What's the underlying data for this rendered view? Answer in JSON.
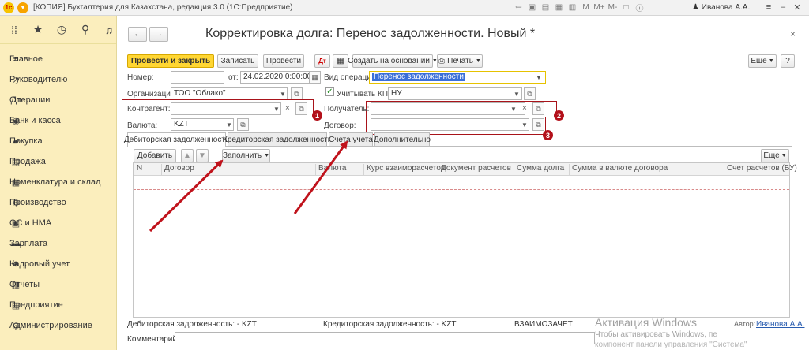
{
  "window": {
    "logo": "1c",
    "title": "[КОПИЯ] Бухгалтерия для Казахстана, редакция 3.0  (1С:Предприятие)",
    "user": "Иванова А.А.",
    "tb_icons": [
      "arrow-left-icon",
      "lock-icon",
      "calendar-icon",
      "chart-icon",
      "note-icon",
      "M",
      "M+",
      "M-",
      "maximize-icon",
      "info-icon"
    ]
  },
  "sidebar": {
    "items": [
      {
        "label": "Главное",
        "icon": "menu-icon"
      },
      {
        "label": "Руководителю",
        "icon": "trend-icon"
      },
      {
        "label": "Операции",
        "icon": "operations-icon"
      },
      {
        "label": "Банк и касса",
        "icon": "bank-icon"
      },
      {
        "label": "Покупка",
        "icon": "cart-icon"
      },
      {
        "label": "Продажа",
        "icon": "sale-icon"
      },
      {
        "label": "Номенклатура и склад",
        "icon": "warehouse-icon"
      },
      {
        "label": "Производство",
        "icon": "factory-icon"
      },
      {
        "label": "ОС и НМА",
        "icon": "assets-icon"
      },
      {
        "label": "Зарплата",
        "icon": "salary-icon"
      },
      {
        "label": "Кадровый учет",
        "icon": "hr-icon"
      },
      {
        "label": "Отчеты",
        "icon": "reports-icon"
      },
      {
        "label": "Предприятие",
        "icon": "enterprise-icon"
      },
      {
        "label": "Администрирование",
        "icon": "admin-icon"
      }
    ]
  },
  "form": {
    "title": "Корректировка долга: Перенос задолженности. Новый *",
    "toolbar": {
      "post_close": "Провести и закрыть",
      "save": "Записать",
      "post": "Провести",
      "create_based": "Создать на основании",
      "print": "Печать",
      "more": "Еще",
      "help": "?"
    },
    "fields": {
      "number_label": "Номер:",
      "number_value": "",
      "date_label": "от:",
      "date_value": "24.02.2020  0:00:00",
      "op_label": "Вид операции:",
      "op_value": "Перенос задолженности",
      "org_label": "Организация:",
      "org_value": "ТОО \"Облако\"",
      "kpn_label": "Учитывать КПН",
      "kpn_checked": true,
      "kpn_value": "НУ",
      "contractor_label": "Контрагент:",
      "contractor_value": "",
      "receiver_label": "Получатель:",
      "receiver_value": "",
      "currency_label": "Валюта:",
      "currency_value": "KZT",
      "contract_label": "Договор:",
      "contract_value": ""
    },
    "badges": [
      "1",
      "2",
      "3"
    ],
    "tabs": [
      "Дебиторская задолженность",
      "Кредиторская задолженность",
      "Счета учета",
      "Дополнительно"
    ],
    "table_toolbar": {
      "add": "Добавить",
      "fill": "Заполнить",
      "more": "Еще"
    },
    "table_columns": [
      "N",
      "Договор",
      "Валюта",
      "Курс взаиморасчетов",
      "Документ расчетов",
      "Сумма долга",
      "Сумма в валюте договора",
      "Счет расчетов (БУ)"
    ],
    "footer": {
      "debit": "Дебиторская задолженность: - KZT",
      "credit": "Кредиторская задолженность: - KZT",
      "offset": "ВЗАИМОЗАЧЕТ",
      "author_label": "Автор:",
      "author_value": "Иванова А.А.",
      "comment_label": "Комментарий:",
      "activation_title": "Активация Windows",
      "activation_line1": "Чтобы активировать Windows, пе",
      "activation_line2": "компонент панели управления \"Система\""
    }
  },
  "colors": {
    "sidebar_bg": "#fbeebd",
    "primary_button": "#ffd633",
    "annotation_red": "#b3101a",
    "selection_blue": "#3a6fd8"
  }
}
